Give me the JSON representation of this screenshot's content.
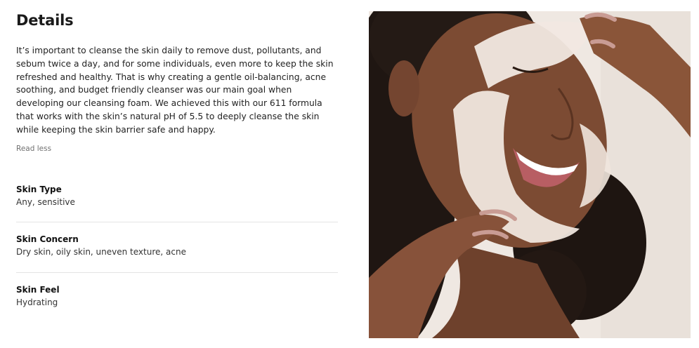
{
  "details": {
    "title": "Details",
    "description": "It’s important to cleanse the skin daily to remove dust, pollutants, and sebum twice a day, and for some individuals, even more to keep the skin refreshed and healthy. That is why creating a gentle oil-balancing, acne soothing, and budget friendly cleanser was our main goal when developing our cleansing foam. We achieved this with our 611 formula that works with the skin’s natural pH of 5.5 to deeply cleanse the skin while keeping the skin barrier safe and happy.",
    "read_less_label": "Read less"
  },
  "attributes": [
    {
      "label": "Skin Type",
      "value": "Any, sensitive"
    },
    {
      "label": "Skin Concern",
      "value": "Dry skin, oily skin, uneven texture, acne"
    },
    {
      "label": "Skin Feel",
      "value": "Hydrating"
    }
  ],
  "image": {
    "background_color": "#efe9e4",
    "skin_color": "#7a4a33",
    "foam_color": "#f3ebe5"
  }
}
